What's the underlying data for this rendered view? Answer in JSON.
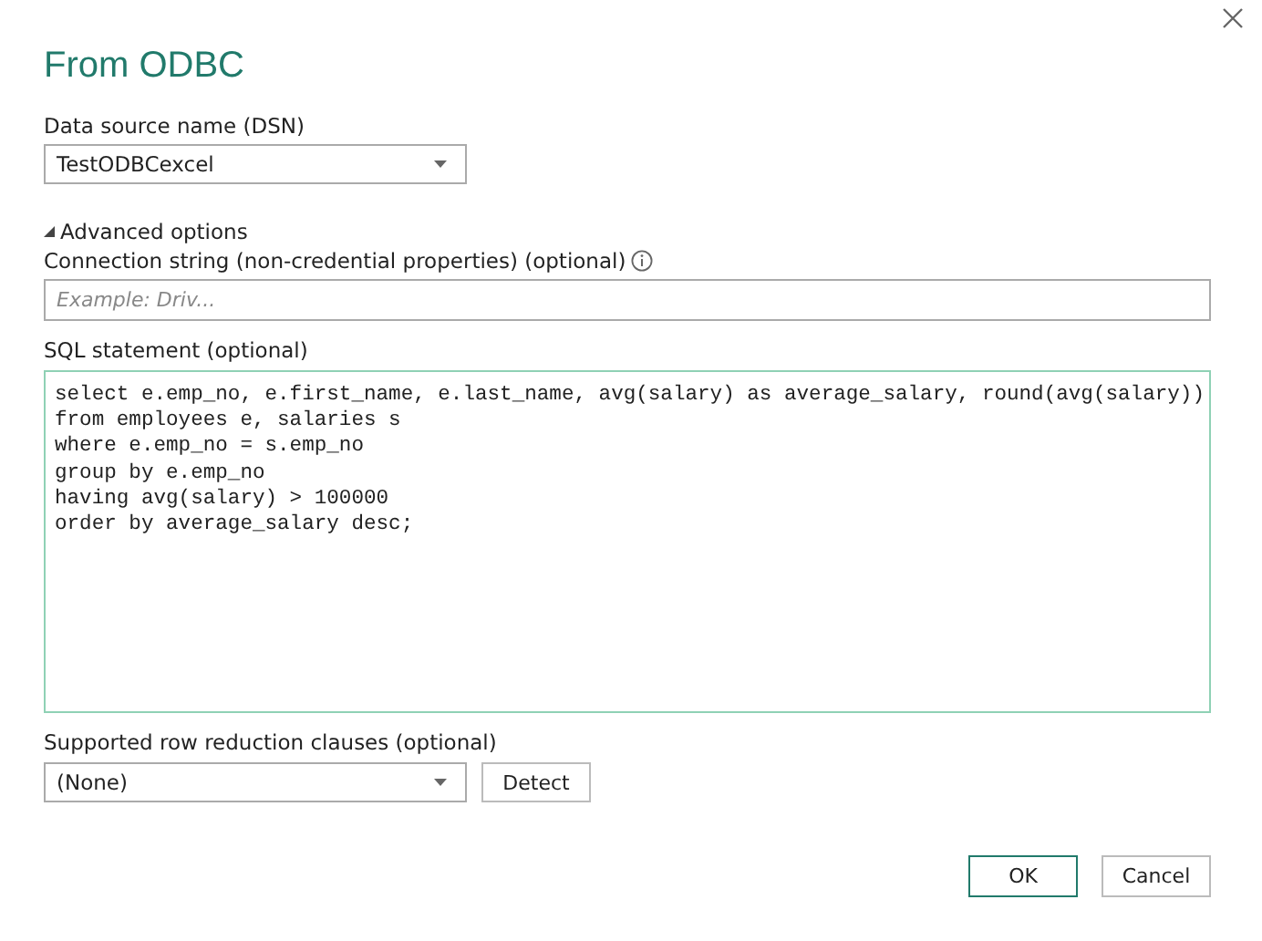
{
  "window": {
    "title": "From ODBC"
  },
  "dsn": {
    "label": "Data source name (DSN)",
    "value": "TestODBCexcel"
  },
  "advanced": {
    "label": "Advanced options",
    "expanded": true
  },
  "connection_string": {
    "label": "Connection string (non-credential properties) (optional)",
    "placeholder": "Example: Driv..."
  },
  "sql": {
    "label": "SQL statement (optional)",
    "value": "select e.emp_no, e.first_name, e.last_name, avg(salary) as average_salary, round(avg(salary))\nfrom employees e, salaries s\nwhere e.emp_no = s.emp_no\ngroup by e.emp_no\nhaving avg(salary) > 100000\norder by average_salary desc;"
  },
  "row_reduction": {
    "label": "Supported row reduction clauses (optional)",
    "value": "(None)",
    "detect_button": "Detect"
  },
  "buttons": [
    {
      "label": "OK",
      "kind": "primary"
    },
    {
      "label": "Cancel",
      "kind": "secondary"
    }
  ]
}
